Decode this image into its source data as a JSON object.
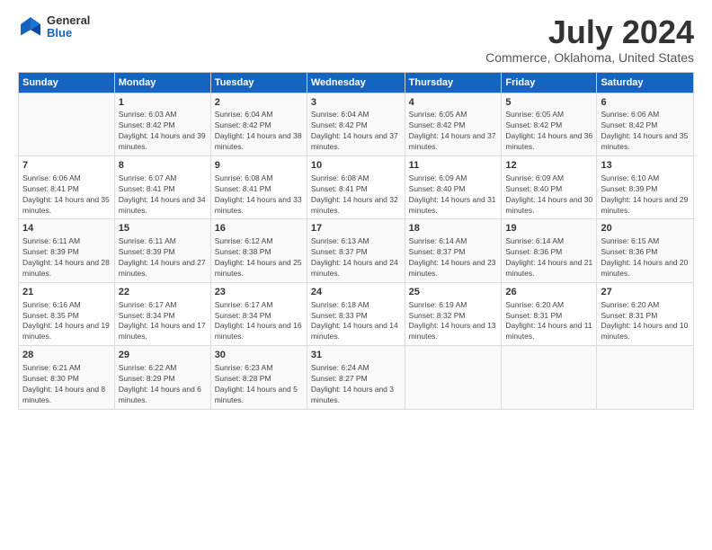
{
  "logo": {
    "general": "General",
    "blue": "Blue"
  },
  "title": "July 2024",
  "subtitle": "Commerce, Oklahoma, United States",
  "days_of_week": [
    "Sunday",
    "Monday",
    "Tuesday",
    "Wednesday",
    "Thursday",
    "Friday",
    "Saturday"
  ],
  "weeks": [
    [
      {
        "day": "",
        "sunrise": "",
        "sunset": "",
        "daylight": ""
      },
      {
        "day": "1",
        "sunrise": "Sunrise: 6:03 AM",
        "sunset": "Sunset: 8:42 PM",
        "daylight": "Daylight: 14 hours and 39 minutes."
      },
      {
        "day": "2",
        "sunrise": "Sunrise: 6:04 AM",
        "sunset": "Sunset: 8:42 PM",
        "daylight": "Daylight: 14 hours and 38 minutes."
      },
      {
        "day": "3",
        "sunrise": "Sunrise: 6:04 AM",
        "sunset": "Sunset: 8:42 PM",
        "daylight": "Daylight: 14 hours and 37 minutes."
      },
      {
        "day": "4",
        "sunrise": "Sunrise: 6:05 AM",
        "sunset": "Sunset: 8:42 PM",
        "daylight": "Daylight: 14 hours and 37 minutes."
      },
      {
        "day": "5",
        "sunrise": "Sunrise: 6:05 AM",
        "sunset": "Sunset: 8:42 PM",
        "daylight": "Daylight: 14 hours and 36 minutes."
      },
      {
        "day": "6",
        "sunrise": "Sunrise: 6:06 AM",
        "sunset": "Sunset: 8:42 PM",
        "daylight": "Daylight: 14 hours and 35 minutes."
      }
    ],
    [
      {
        "day": "7",
        "sunrise": "Sunrise: 6:06 AM",
        "sunset": "Sunset: 8:41 PM",
        "daylight": "Daylight: 14 hours and 35 minutes."
      },
      {
        "day": "8",
        "sunrise": "Sunrise: 6:07 AM",
        "sunset": "Sunset: 8:41 PM",
        "daylight": "Daylight: 14 hours and 34 minutes."
      },
      {
        "day": "9",
        "sunrise": "Sunrise: 6:08 AM",
        "sunset": "Sunset: 8:41 PM",
        "daylight": "Daylight: 14 hours and 33 minutes."
      },
      {
        "day": "10",
        "sunrise": "Sunrise: 6:08 AM",
        "sunset": "Sunset: 8:41 PM",
        "daylight": "Daylight: 14 hours and 32 minutes."
      },
      {
        "day": "11",
        "sunrise": "Sunrise: 6:09 AM",
        "sunset": "Sunset: 8:40 PM",
        "daylight": "Daylight: 14 hours and 31 minutes."
      },
      {
        "day": "12",
        "sunrise": "Sunrise: 6:09 AM",
        "sunset": "Sunset: 8:40 PM",
        "daylight": "Daylight: 14 hours and 30 minutes."
      },
      {
        "day": "13",
        "sunrise": "Sunrise: 6:10 AM",
        "sunset": "Sunset: 8:39 PM",
        "daylight": "Daylight: 14 hours and 29 minutes."
      }
    ],
    [
      {
        "day": "14",
        "sunrise": "Sunrise: 6:11 AM",
        "sunset": "Sunset: 8:39 PM",
        "daylight": "Daylight: 14 hours and 28 minutes."
      },
      {
        "day": "15",
        "sunrise": "Sunrise: 6:11 AM",
        "sunset": "Sunset: 8:39 PM",
        "daylight": "Daylight: 14 hours and 27 minutes."
      },
      {
        "day": "16",
        "sunrise": "Sunrise: 6:12 AM",
        "sunset": "Sunset: 8:38 PM",
        "daylight": "Daylight: 14 hours and 25 minutes."
      },
      {
        "day": "17",
        "sunrise": "Sunrise: 6:13 AM",
        "sunset": "Sunset: 8:37 PM",
        "daylight": "Daylight: 14 hours and 24 minutes."
      },
      {
        "day": "18",
        "sunrise": "Sunrise: 6:14 AM",
        "sunset": "Sunset: 8:37 PM",
        "daylight": "Daylight: 14 hours and 23 minutes."
      },
      {
        "day": "19",
        "sunrise": "Sunrise: 6:14 AM",
        "sunset": "Sunset: 8:36 PM",
        "daylight": "Daylight: 14 hours and 21 minutes."
      },
      {
        "day": "20",
        "sunrise": "Sunrise: 6:15 AM",
        "sunset": "Sunset: 8:36 PM",
        "daylight": "Daylight: 14 hours and 20 minutes."
      }
    ],
    [
      {
        "day": "21",
        "sunrise": "Sunrise: 6:16 AM",
        "sunset": "Sunset: 8:35 PM",
        "daylight": "Daylight: 14 hours and 19 minutes."
      },
      {
        "day": "22",
        "sunrise": "Sunrise: 6:17 AM",
        "sunset": "Sunset: 8:34 PM",
        "daylight": "Daylight: 14 hours and 17 minutes."
      },
      {
        "day": "23",
        "sunrise": "Sunrise: 6:17 AM",
        "sunset": "Sunset: 8:34 PM",
        "daylight": "Daylight: 14 hours and 16 minutes."
      },
      {
        "day": "24",
        "sunrise": "Sunrise: 6:18 AM",
        "sunset": "Sunset: 8:33 PM",
        "daylight": "Daylight: 14 hours and 14 minutes."
      },
      {
        "day": "25",
        "sunrise": "Sunrise: 6:19 AM",
        "sunset": "Sunset: 8:32 PM",
        "daylight": "Daylight: 14 hours and 13 minutes."
      },
      {
        "day": "26",
        "sunrise": "Sunrise: 6:20 AM",
        "sunset": "Sunset: 8:31 PM",
        "daylight": "Daylight: 14 hours and 11 minutes."
      },
      {
        "day": "27",
        "sunrise": "Sunrise: 6:20 AM",
        "sunset": "Sunset: 8:31 PM",
        "daylight": "Daylight: 14 hours and 10 minutes."
      }
    ],
    [
      {
        "day": "28",
        "sunrise": "Sunrise: 6:21 AM",
        "sunset": "Sunset: 8:30 PM",
        "daylight": "Daylight: 14 hours and 8 minutes."
      },
      {
        "day": "29",
        "sunrise": "Sunrise: 6:22 AM",
        "sunset": "Sunset: 8:29 PM",
        "daylight": "Daylight: 14 hours and 6 minutes."
      },
      {
        "day": "30",
        "sunrise": "Sunrise: 6:23 AM",
        "sunset": "Sunset: 8:28 PM",
        "daylight": "Daylight: 14 hours and 5 minutes."
      },
      {
        "day": "31",
        "sunrise": "Sunrise: 6:24 AM",
        "sunset": "Sunset: 8:27 PM",
        "daylight": "Daylight: 14 hours and 3 minutes."
      },
      {
        "day": "",
        "sunrise": "",
        "sunset": "",
        "daylight": ""
      },
      {
        "day": "",
        "sunrise": "",
        "sunset": "",
        "daylight": ""
      },
      {
        "day": "",
        "sunrise": "",
        "sunset": "",
        "daylight": ""
      }
    ]
  ]
}
